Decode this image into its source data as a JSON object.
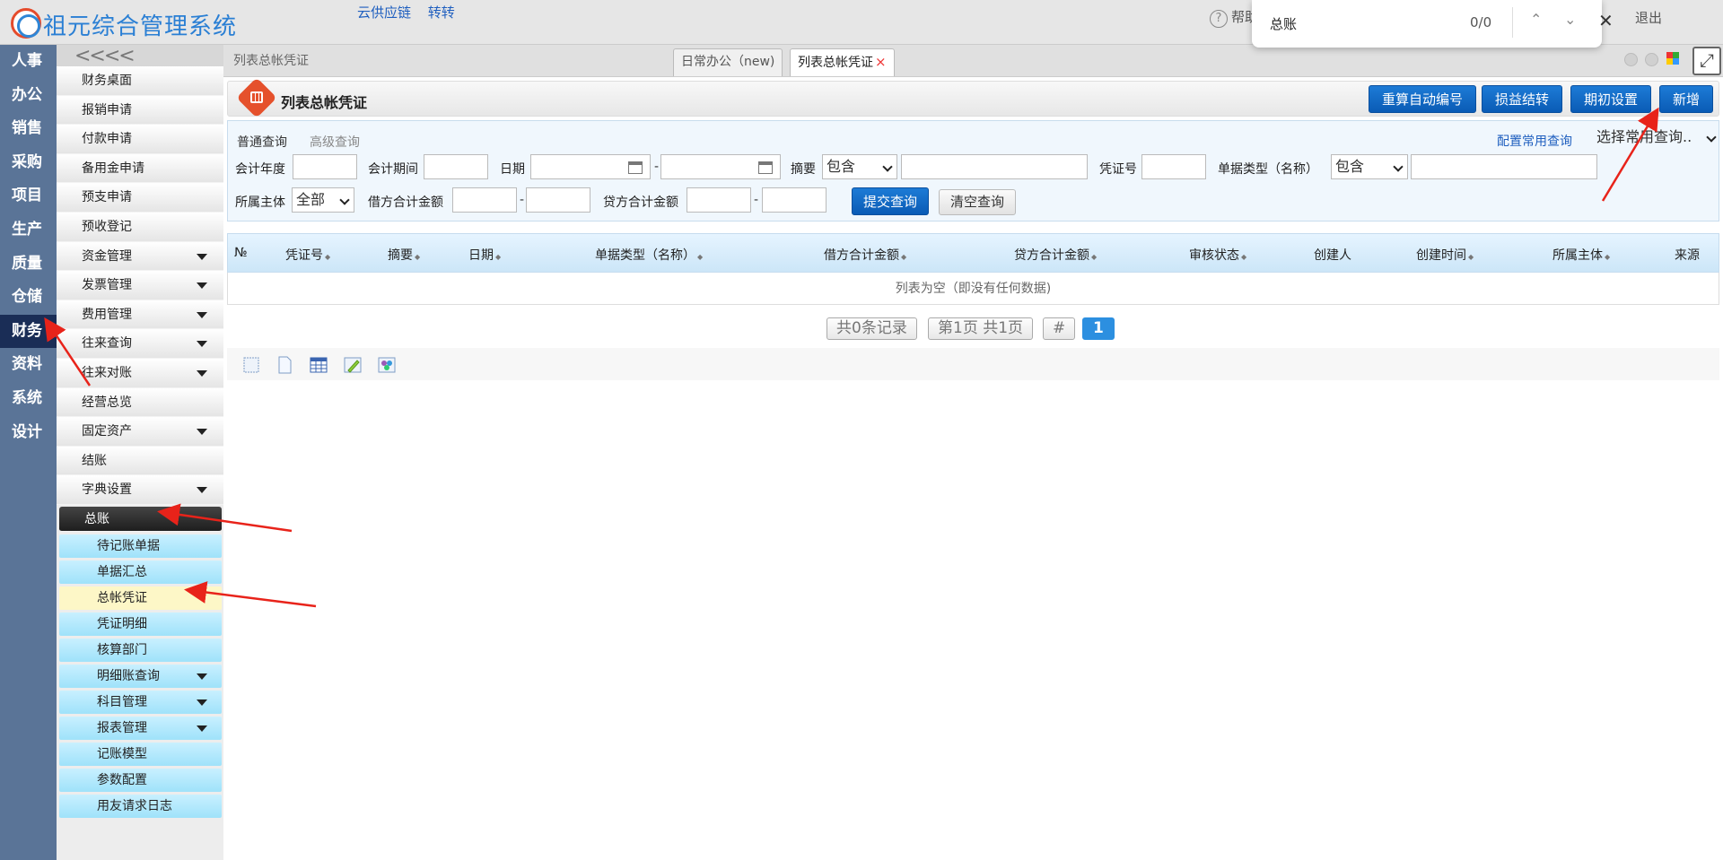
{
  "app": {
    "title": "祖元综合管理系统"
  },
  "top_links": [
    "云供应链",
    "转转"
  ],
  "header_right": {
    "help": "帮助",
    "logout": "退出"
  },
  "find": {
    "text": "总账",
    "count": "0/0"
  },
  "left_nav": [
    "人事",
    "办公",
    "销售",
    "采购",
    "项目",
    "生产",
    "质量",
    "仓储",
    "财务",
    "资料",
    "系统",
    "设计"
  ],
  "left_nav_active": "财务",
  "submenu": {
    "collapse": "<<",
    "items": [
      {
        "label": "财务桌面",
        "arrow": false
      },
      {
        "label": "报销申请",
        "arrow": false
      },
      {
        "label": "付款申请",
        "arrow": false
      },
      {
        "label": "备用金申请",
        "arrow": false
      },
      {
        "label": "预支申请",
        "arrow": false
      },
      {
        "label": "预收登记",
        "arrow": false
      },
      {
        "label": "资金管理",
        "arrow": true
      },
      {
        "label": "发票管理",
        "arrow": true
      },
      {
        "label": "费用管理",
        "arrow": true
      },
      {
        "label": "往来查询",
        "arrow": true
      },
      {
        "label": "往来对账",
        "arrow": true
      },
      {
        "label": "经营总览",
        "arrow": false
      },
      {
        "label": "固定资产",
        "arrow": true
      },
      {
        "label": "结账",
        "arrow": false
      },
      {
        "label": "字典设置",
        "arrow": true
      }
    ],
    "group": {
      "label": "总账"
    },
    "group_items": [
      {
        "label": "待记账单据",
        "arrow": false,
        "active": false
      },
      {
        "label": "单据汇总",
        "arrow": false,
        "active": false
      },
      {
        "label": "总帐凭证",
        "arrow": false,
        "active": true
      },
      {
        "label": "凭证明细",
        "arrow": false,
        "active": false
      },
      {
        "label": "核算部门",
        "arrow": false,
        "active": false
      },
      {
        "label": "明细账查询",
        "arrow": true,
        "active": false
      },
      {
        "label": "科目管理",
        "arrow": true,
        "active": false
      },
      {
        "label": "报表管理",
        "arrow": true,
        "active": false
      },
      {
        "label": "记账模型",
        "arrow": false,
        "active": false
      },
      {
        "label": "参数配置",
        "arrow": false,
        "active": false
      },
      {
        "label": "用友请求日志",
        "arrow": false,
        "active": false
      }
    ]
  },
  "tabbar": {
    "crumb": "列表总帐凭证",
    "tabs": [
      {
        "label": "日常办公（new)",
        "active": false
      },
      {
        "label": "列表总帐凭证",
        "active": true,
        "close": "×"
      }
    ]
  },
  "page": {
    "title": "列表总帐凭证",
    "buttons": [
      "重算自动编号",
      "损益结转",
      "期初设置",
      "新增"
    ]
  },
  "query": {
    "tab_normal": "普通查询",
    "tab_advanced": "高级查询",
    "config_link": "配置常用查询",
    "preset_select": "选择常用查询..",
    "labels": {
      "year": "会计年度",
      "period": "会计期间",
      "date": "日期",
      "summary": "摘要",
      "voucher_no": "凭证号",
      "doc_type": "单据类型（名称）",
      "entity": "所属主体",
      "debit_total": "借方合计金额",
      "credit_total": "贷方合计金额"
    },
    "summary_mode": "包含",
    "doc_type_mode": "包含",
    "entity_value": "全部",
    "dash": "-",
    "submit": "提交查询",
    "clear": "清空查询"
  },
  "table": {
    "columns": [
      "№",
      "凭证号",
      "摘要",
      "日期",
      "单据类型（名称）",
      "借方合计金额",
      "贷方合计金额",
      "审核状态",
      "创建人",
      "创建时间",
      "所属主体",
      "来源"
    ],
    "sortable": [
      false,
      true,
      true,
      true,
      true,
      true,
      true,
      true,
      false,
      true,
      true,
      false
    ],
    "empty": "列表为空（即没有任何数据)"
  },
  "pager": {
    "records": "共0条记录",
    "pages": "第1页 共1页",
    "hash": "#",
    "current": "1"
  },
  "toolbar_icons": [
    "select-all-icon",
    "blank-page-icon",
    "table-icon",
    "edit-icon",
    "puzzle-icon"
  ],
  "colors": {
    "accent_blue": "#0a5bb5",
    "nav_bg": "#5a7497",
    "annotation_red": "#e8231a"
  }
}
